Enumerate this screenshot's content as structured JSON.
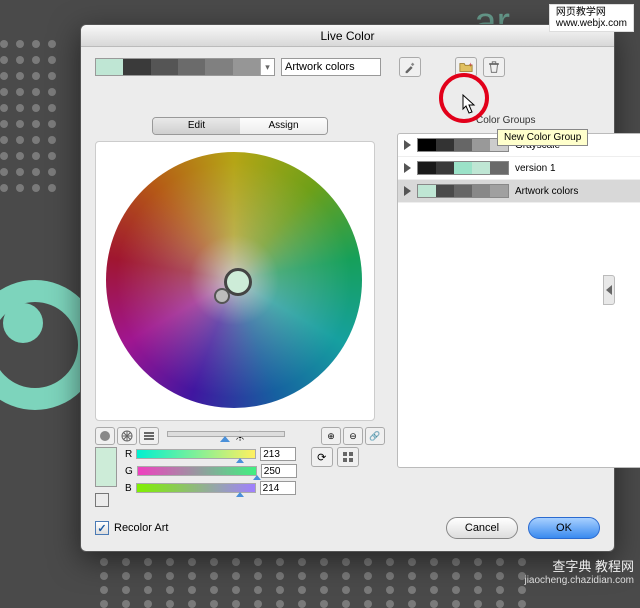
{
  "watermarks": {
    "top": "网页教学网\nwww.webjx.com",
    "bottom_main": "查字典 教程网",
    "bottom_sub": "jiaocheng.chazidian.com"
  },
  "dialog": {
    "title": "Live Color"
  },
  "swatch": {
    "colors": [
      "#bfe6d4",
      "#3a3a3a",
      "#555555",
      "#6b6b6b",
      "#808080",
      "#969696"
    ],
    "label_value": "Artwork colors"
  },
  "toolbar": {
    "eyedropper_name": "eyedropper-icon",
    "new_group_name": "folder-plus-icon",
    "delete_name": "trash-icon"
  },
  "color_groups_label": "Color Groups",
  "tooltip": "New Color Group",
  "tabs": {
    "edit": "Edit",
    "assign": "Assign"
  },
  "groups": [
    {
      "name": "Grayscale",
      "colors": [
        "#000000",
        "#333333",
        "#666666",
        "#999999",
        "#cccccc"
      ],
      "selected": false
    },
    {
      "name": "version 1",
      "colors": [
        "#1a1a1a",
        "#3a3a3a",
        "#9be2c8",
        "#bfe6d4",
        "#6a6a6a"
      ],
      "selected": false
    },
    {
      "name": "Artwork colors",
      "colors": [
        "#bfe6d4",
        "#4a4a4a",
        "#666666",
        "#888888",
        "#a0a0a0"
      ],
      "selected": true
    }
  ],
  "rgb": {
    "r_label": "R",
    "g_label": "G",
    "b_label": "B",
    "r": "213",
    "g": "250",
    "b": "214",
    "r_pos": "84%",
    "g_pos": "98%",
    "b_pos": "84%"
  },
  "footer": {
    "recolor_label": "Recolor Art",
    "cancel": "Cancel",
    "ok": "OK"
  }
}
